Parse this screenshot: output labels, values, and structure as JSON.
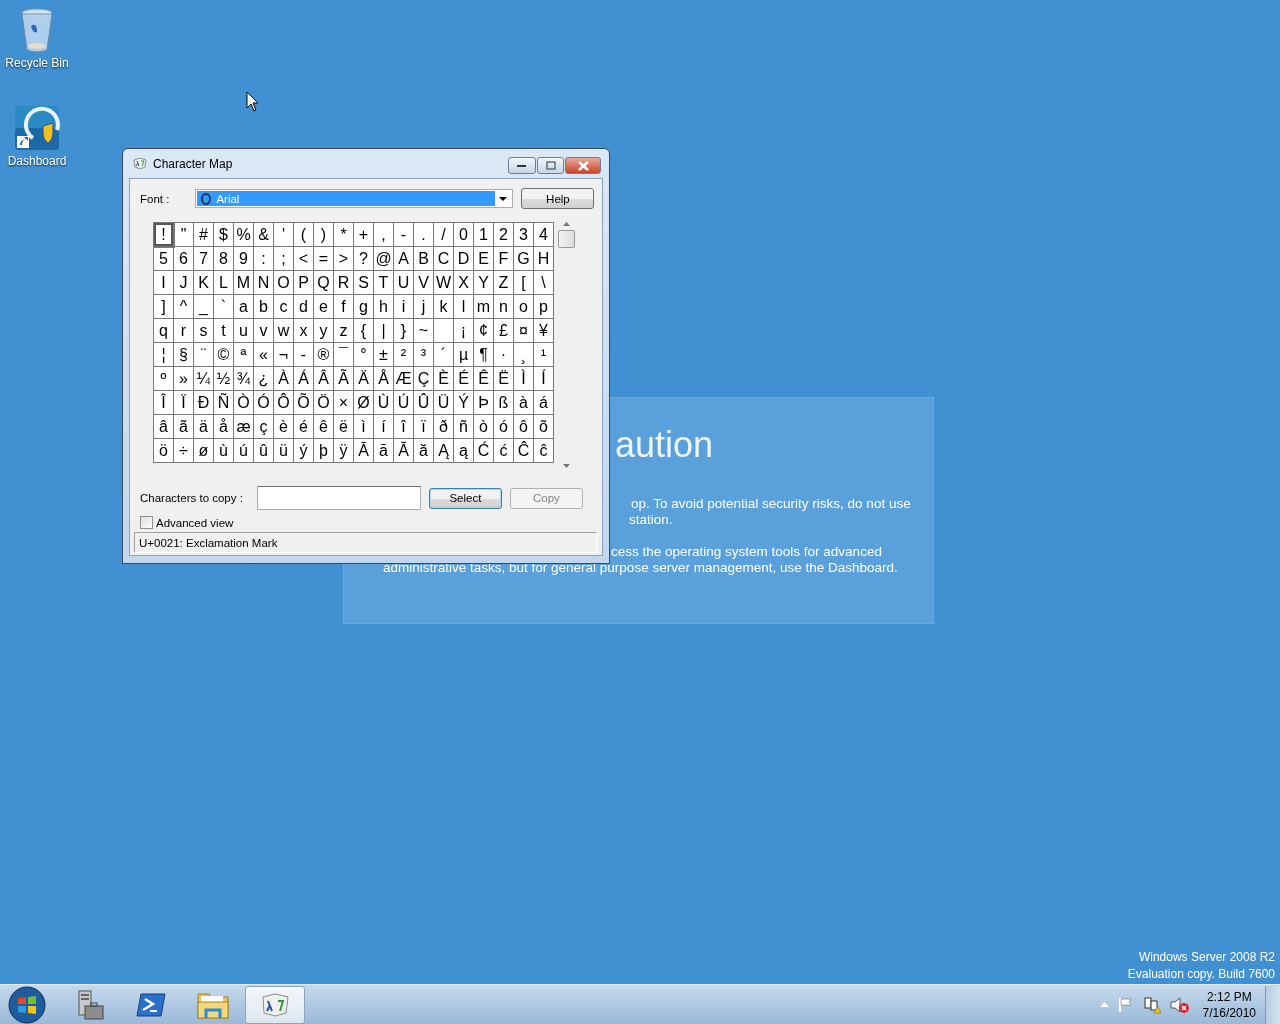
{
  "desktop_icons": [
    {
      "label": "Recycle Bin",
      "kind": "bin"
    },
    {
      "label": "Dashboard",
      "kind": "dashboard"
    }
  ],
  "caution_panel": {
    "heading": "aution",
    "paragraphs": [
      [
        "op. To avoid potential security risks, do not use",
        "station."
      ],
      [
        "cess the operating system tools for advanced",
        "administrative tasks, but for general purpose server management, use the Dashboard."
      ]
    ]
  },
  "window": {
    "title": "Character Map",
    "font_label": "Font :",
    "font_value": "Arial",
    "help_button": "Help",
    "grid": [
      [
        {
          "c": "!",
          "selected": true
        },
        {
          "c": "\"",
          "selected": false
        },
        {
          "c": "#",
          "selected": false
        },
        {
          "c": "$",
          "selected": false
        },
        {
          "c": "%",
          "selected": false
        },
        {
          "c": "&",
          "selected": false
        },
        {
          "c": "'",
          "selected": false
        },
        {
          "c": "(",
          "selected": false
        },
        {
          "c": ")",
          "selected": false
        },
        {
          "c": "*",
          "selected": false
        },
        {
          "c": "+",
          "selected": false
        },
        {
          "c": ",",
          "selected": false
        },
        {
          "c": "-",
          "selected": false
        },
        {
          "c": ".",
          "selected": false
        },
        {
          "c": "/",
          "selected": false
        },
        {
          "c": "0",
          "selected": false
        },
        {
          "c": "1",
          "selected": false
        },
        {
          "c": "2",
          "selected": false
        },
        {
          "c": "3",
          "selected": false
        },
        {
          "c": "4",
          "selected": false
        }
      ],
      [
        {
          "c": "5",
          "selected": false
        },
        {
          "c": "6",
          "selected": false
        },
        {
          "c": "7",
          "selected": false
        },
        {
          "c": "8",
          "selected": false
        },
        {
          "c": "9",
          "selected": false
        },
        {
          "c": ":",
          "selected": false
        },
        {
          "c": ";",
          "selected": false
        },
        {
          "c": "<",
          "selected": false
        },
        {
          "c": "=",
          "selected": false
        },
        {
          "c": ">",
          "selected": false
        },
        {
          "c": "?",
          "selected": false
        },
        {
          "c": "@",
          "selected": false
        },
        {
          "c": "A",
          "selected": false
        },
        {
          "c": "B",
          "selected": false
        },
        {
          "c": "C",
          "selected": false
        },
        {
          "c": "D",
          "selected": false
        },
        {
          "c": "E",
          "selected": false
        },
        {
          "c": "F",
          "selected": false
        },
        {
          "c": "G",
          "selected": false
        },
        {
          "c": "H",
          "selected": false
        }
      ],
      [
        {
          "c": "I",
          "selected": false
        },
        {
          "c": "J",
          "selected": false
        },
        {
          "c": "K",
          "selected": false
        },
        {
          "c": "L",
          "selected": false
        },
        {
          "c": "M",
          "selected": false
        },
        {
          "c": "N",
          "selected": false
        },
        {
          "c": "O",
          "selected": false
        },
        {
          "c": "P",
          "selected": false
        },
        {
          "c": "Q",
          "selected": false
        },
        {
          "c": "R",
          "selected": false
        },
        {
          "c": "S",
          "selected": false
        },
        {
          "c": "T",
          "selected": false
        },
        {
          "c": "U",
          "selected": false
        },
        {
          "c": "V",
          "selected": false
        },
        {
          "c": "W",
          "selected": false
        },
        {
          "c": "X",
          "selected": false
        },
        {
          "c": "Y",
          "selected": false
        },
        {
          "c": "Z",
          "selected": false
        },
        {
          "c": "[",
          "selected": false
        },
        {
          "c": "\\",
          "selected": false
        }
      ],
      [
        {
          "c": "]",
          "selected": false
        },
        {
          "c": "^",
          "selected": false
        },
        {
          "c": "_",
          "selected": false
        },
        {
          "c": "`",
          "selected": false
        },
        {
          "c": "a",
          "selected": false
        },
        {
          "c": "b",
          "selected": false
        },
        {
          "c": "c",
          "selected": false
        },
        {
          "c": "d",
          "selected": false
        },
        {
          "c": "e",
          "selected": false
        },
        {
          "c": "f",
          "selected": false
        },
        {
          "c": "g",
          "selected": false
        },
        {
          "c": "h",
          "selected": false
        },
        {
          "c": "i",
          "selected": false
        },
        {
          "c": "j",
          "selected": false
        },
        {
          "c": "k",
          "selected": false
        },
        {
          "c": "l",
          "selected": false
        },
        {
          "c": "m",
          "selected": false
        },
        {
          "c": "n",
          "selected": false
        },
        {
          "c": "o",
          "selected": false
        },
        {
          "c": "p",
          "selected": false
        }
      ],
      [
        {
          "c": "q",
          "selected": false
        },
        {
          "c": "r",
          "selected": false
        },
        {
          "c": "s",
          "selected": false
        },
        {
          "c": "t",
          "selected": false
        },
        {
          "c": "u",
          "selected": false
        },
        {
          "c": "v",
          "selected": false
        },
        {
          "c": "w",
          "selected": false
        },
        {
          "c": "x",
          "selected": false
        },
        {
          "c": "y",
          "selected": false
        },
        {
          "c": "z",
          "selected": false
        },
        {
          "c": "{",
          "selected": false
        },
        {
          "c": "|",
          "selected": false
        },
        {
          "c": "}",
          "selected": false
        },
        {
          "c": "~",
          "selected": false
        },
        {
          "selected": false
        },
        {
          "c": "¡",
          "selected": false
        },
        {
          "c": "¢",
          "selected": false
        },
        {
          "c": "£",
          "selected": false
        },
        {
          "c": "¤",
          "selected": false
        },
        {
          "c": "¥",
          "selected": false
        }
      ],
      [
        {
          "c": "¦",
          "selected": false
        },
        {
          "c": "§",
          "selected": false
        },
        {
          "c": "¨",
          "selected": false
        },
        {
          "c": "©",
          "selected": false
        },
        {
          "c": "ª",
          "selected": false
        },
        {
          "c": "«",
          "selected": false
        },
        {
          "c": "¬",
          "selected": false
        },
        {
          "c": "-",
          "selected": false
        },
        {
          "c": "®",
          "selected": false
        },
        {
          "c": "¯",
          "selected": false
        },
        {
          "c": "°",
          "selected": false
        },
        {
          "c": "±",
          "selected": false
        },
        {
          "c": "²",
          "selected": false
        },
        {
          "c": "³",
          "selected": false
        },
        {
          "c": "´",
          "selected": false
        },
        {
          "c": "µ",
          "selected": false
        },
        {
          "c": "¶",
          "selected": false
        },
        {
          "c": "·",
          "selected": false
        },
        {
          "c": "¸",
          "selected": false
        },
        {
          "c": "¹",
          "selected": false
        }
      ],
      [
        {
          "c": "º",
          "selected": false
        },
        {
          "c": "»",
          "selected": false
        },
        {
          "c": "¼",
          "selected": false
        },
        {
          "c": "½",
          "selected": false
        },
        {
          "c": "¾",
          "selected": false
        },
        {
          "c": "¿",
          "selected": false
        },
        {
          "c": "À",
          "selected": false
        },
        {
          "c": "Á",
          "selected": false
        },
        {
          "c": "Â",
          "selected": false
        },
        {
          "c": "Ã",
          "selected": false
        },
        {
          "c": "Ä",
          "selected": false
        },
        {
          "c": "Å",
          "selected": false
        },
        {
          "c": "Æ",
          "selected": false
        },
        {
          "c": "Ç",
          "selected": false
        },
        {
          "c": "È",
          "selected": false
        },
        {
          "c": "É",
          "selected": false
        },
        {
          "c": "Ê",
          "selected": false
        },
        {
          "c": "Ë",
          "selected": false
        },
        {
          "c": "Ì",
          "selected": false
        },
        {
          "c": "Í",
          "selected": false
        }
      ],
      [
        {
          "c": "Î",
          "selected": false
        },
        {
          "c": "Ï",
          "selected": false
        },
        {
          "c": "Ð",
          "selected": false
        },
        {
          "c": "Ñ",
          "selected": false
        },
        {
          "c": "Ò",
          "selected": false
        },
        {
          "c": "Ó",
          "selected": false
        },
        {
          "c": "Ô",
          "selected": false
        },
        {
          "c": "Õ",
          "selected": false
        },
        {
          "c": "Ö",
          "selected": false
        },
        {
          "c": "×",
          "selected": false
        },
        {
          "c": "Ø",
          "selected": false
        },
        {
          "c": "Ù",
          "selected": false
        },
        {
          "c": "Ú",
          "selected": false
        },
        {
          "c": "Û",
          "selected": false
        },
        {
          "c": "Ü",
          "selected": false
        },
        {
          "c": "Ý",
          "selected": false
        },
        {
          "c": "Þ",
          "selected": false
        },
        {
          "c": "ß",
          "selected": false
        },
        {
          "c": "à",
          "selected": false
        },
        {
          "c": "á",
          "selected": false
        }
      ],
      [
        {
          "c": "â",
          "selected": false
        },
        {
          "c": "ã",
          "selected": false
        },
        {
          "c": "ä",
          "selected": false
        },
        {
          "c": "å",
          "selected": false
        },
        {
          "c": "æ",
          "selected": false
        },
        {
          "c": "ç",
          "selected": false
        },
        {
          "c": "è",
          "selected": false
        },
        {
          "c": "é",
          "selected": false
        },
        {
          "c": "ê",
          "selected": false
        },
        {
          "c": "ë",
          "selected": false
        },
        {
          "c": "ì",
          "selected": false
        },
        {
          "c": "í",
          "selected": false
        },
        {
          "c": "î",
          "selected": false
        },
        {
          "c": "ï",
          "selected": false
        },
        {
          "c": "ð",
          "selected": false
        },
        {
          "c": "ñ",
          "selected": false
        },
        {
          "c": "ò",
          "selected": false
        },
        {
          "c": "ó",
          "selected": false
        },
        {
          "c": "ô",
          "selected": false
        },
        {
          "c": "õ",
          "selected": false
        }
      ],
      [
        {
          "c": "ö",
          "selected": false
        },
        {
          "c": "÷",
          "selected": false
        },
        {
          "c": "ø",
          "selected": false
        },
        {
          "c": "ù",
          "selected": false
        },
        {
          "c": "ú",
          "selected": false
        },
        {
          "c": "û",
          "selected": false
        },
        {
          "c": "ü",
          "selected": false
        },
        {
          "c": "ý",
          "selected": false
        },
        {
          "c": "þ",
          "selected": false
        },
        {
          "c": "ÿ",
          "selected": false
        },
        {
          "c": "Ā",
          "selected": false
        },
        {
          "c": "ā",
          "selected": false
        },
        {
          "c": "Ă",
          "selected": false
        },
        {
          "c": "ă",
          "selected": false
        },
        {
          "c": "Ą",
          "selected": false
        },
        {
          "c": "ą",
          "selected": false
        },
        {
          "c": "Ć",
          "selected": false
        },
        {
          "c": "ć",
          "selected": false
        },
        {
          "c": "Ĉ",
          "selected": false
        },
        {
          "c": "ĉ",
          "selected": false
        }
      ]
    ],
    "copy_label": "Characters to copy :",
    "select_button": "Select",
    "copy_button": {
      "label": "Copy",
      "disabled": true
    },
    "advanced_view": {
      "label": "Advanced view",
      "checked": false
    },
    "status": "U+0021: Exclamation Mark"
  },
  "os_version": [
    "Windows Server 2008 R2",
    "Evaluation copy. Build 7600"
  ],
  "taskbar": {
    "buttons": [
      {
        "kind": "server",
        "selected": false
      },
      {
        "kind": "shell",
        "selected": false
      },
      {
        "kind": "folder",
        "selected": false
      },
      {
        "kind": "charmap",
        "selected": true
      }
    ],
    "clock": {
      "time": "2:12 PM",
      "date": "7/16/2010"
    }
  }
}
